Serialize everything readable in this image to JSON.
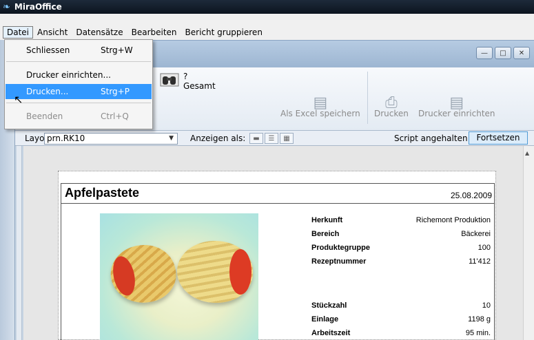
{
  "app": {
    "title": "MiraOffice"
  },
  "menubar": [
    "Datei",
    "Ansicht",
    "Datensätze",
    "Bearbeiten",
    "Bericht gruppieren"
  ],
  "file_menu": {
    "items": [
      {
        "label": "Schliessen",
        "shortcut": "Strg+W"
      },
      {
        "label": "Drucker einrichten..."
      },
      {
        "label": "Drucken...",
        "shortcut": "Strg+P"
      },
      {
        "label": "Beenden",
        "shortcut": "Ctrl+Q"
      }
    ]
  },
  "toolbar": {
    "search_label_top": "?",
    "search_label_bottom": "Gesamt",
    "excel_label": "Als Excel speichern",
    "print_label": "Drucken",
    "printer_setup_label": "Drucker einrichten"
  },
  "layoutbar": {
    "layout_label": "Layout:",
    "layout_value": "prn.RK10",
    "show_as_label": "Anzeigen als:",
    "script_status": "Script angehalten",
    "continue_label": "Fortsetzen"
  },
  "record": {
    "title": "Apfelpastete",
    "date": "25.08.2009",
    "fields": [
      {
        "label": "Herkunft",
        "value": "Richemont Produktion"
      },
      {
        "label": "Bereich",
        "value": "Bäckerei"
      },
      {
        "label": "Produktegruppe",
        "value": "100"
      },
      {
        "label": "Rezeptnummer",
        "value": "11'412"
      },
      {
        "label": "Stückzahl",
        "value": "10"
      },
      {
        "label": "Einlage",
        "value": "1198 g"
      },
      {
        "label": "Arbeitszeit",
        "value": "95 min."
      }
    ]
  },
  "colors": {
    "highlight": "#3399ff",
    "titlebar": "#0c141f"
  }
}
